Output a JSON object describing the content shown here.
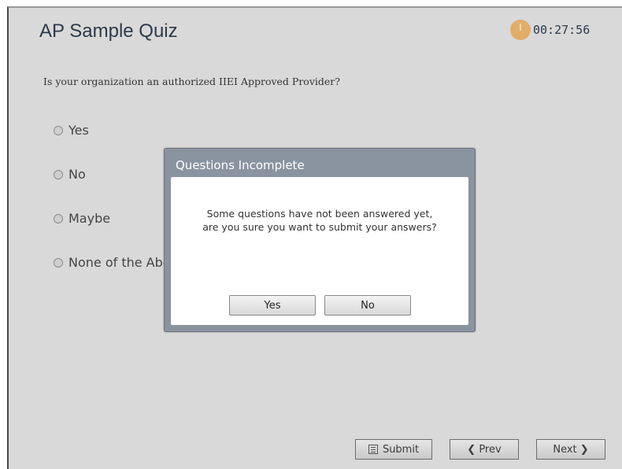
{
  "quiz": {
    "title": "AP Sample Quiz",
    "timer": "00:27:56",
    "question": "Is your organization an authorized IIEI Approved Provider?",
    "options": [
      "Yes",
      "No",
      "Maybe",
      "None of the Above"
    ]
  },
  "dialog": {
    "title": "Questions Incomplete",
    "message_line1": "Some questions have not been answered yet,",
    "message_line2": "are you sure you want to submit your answers?",
    "yes_label": "Yes",
    "no_label": "No"
  },
  "footer": {
    "submit_label": "Submit",
    "prev_label": "❮ Prev",
    "next_label": "Next ❯"
  },
  "colors": {
    "background": "#d9d9d9",
    "dialog_header": "#8a93a0",
    "timer_icon": "#e2ad67"
  }
}
